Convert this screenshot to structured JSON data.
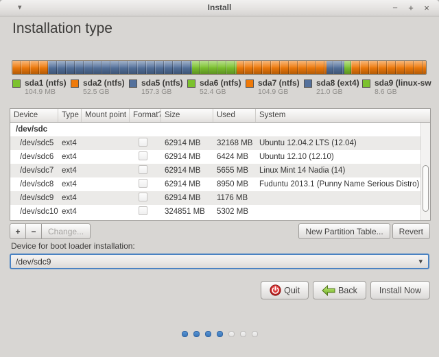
{
  "window": {
    "title": "Install",
    "menu_arrow": "▾",
    "minimize": "−",
    "maximize": "+",
    "close": "×"
  },
  "page": {
    "title": "Installation type"
  },
  "partition_bar": {
    "colors": {
      "orange": "#ef7a0a",
      "blue": "#54719c",
      "green": "#7cc22e"
    },
    "segments": [
      {
        "color": "orange",
        "width_pct": 8.6
      },
      {
        "color": "blue",
        "width_pct": 34.9
      },
      {
        "color": "green",
        "width_pct": 10.7
      },
      {
        "color": "orange",
        "width_pct": 21.8
      },
      {
        "color": "blue",
        "width_pct": 4.3
      },
      {
        "color": "green",
        "width_pct": 1.7
      },
      {
        "color": "orange",
        "width_pct": 18.0
      }
    ]
  },
  "legend": [
    {
      "name": "sda1 (ntfs)",
      "size": "104.9 MB",
      "color": "green"
    },
    {
      "name": "sda2 (ntfs)",
      "size": "52.5 GB",
      "color": "orange"
    },
    {
      "name": "sda5 (ntfs)",
      "size": "157.3 GB",
      "color": "blue"
    },
    {
      "name": "sda6 (ntfs)",
      "size": "52.4 GB",
      "color": "green"
    },
    {
      "name": "sda7 (ntfs)",
      "size": "104.9 GB",
      "color": "orange"
    },
    {
      "name": "sda8 (ext4)",
      "size": "21.0 GB",
      "color": "blue"
    },
    {
      "name": "sda9 (linux-sw",
      "size": "8.6 GB",
      "color": "green"
    }
  ],
  "table": {
    "columns": [
      "Device",
      "Type",
      "Mount point",
      "Format?",
      "Size",
      "Used",
      "System"
    ],
    "rows": [
      {
        "device": "/dev/sdc",
        "type": "",
        "mount_point": "",
        "size": "",
        "used": "",
        "system": ""
      },
      {
        "device": "/dev/sdc5",
        "type": "ext4",
        "mount_point": "",
        "size": "62914 MB",
        "used": "32168 MB",
        "system": "Ubuntu 12.04.2 LTS (12.04)"
      },
      {
        "device": "/dev/sdc6",
        "type": "ext4",
        "mount_point": "",
        "size": "62914 MB",
        "used": "6424 MB",
        "system": "Ubuntu 12.10 (12.10)"
      },
      {
        "device": "/dev/sdc7",
        "type": "ext4",
        "mount_point": "",
        "size": "62914 MB",
        "used": "5655 MB",
        "system": "Linux Mint 14 Nadia (14)"
      },
      {
        "device": "/dev/sdc8",
        "type": "ext4",
        "mount_point": "",
        "size": "62914 MB",
        "used": "8950 MB",
        "system": "Fuduntu 2013.1 (Punny Name Serious Distro)"
      },
      {
        "device": "/dev/sdc9",
        "type": "ext4",
        "mount_point": "",
        "size": "62914 MB",
        "used": "1176 MB",
        "system": ""
      },
      {
        "device": "/dev/sdc10",
        "type": "ext4",
        "mount_point": "",
        "size": "324851 MB",
        "used": "5302 MB",
        "system": ""
      }
    ]
  },
  "actions": {
    "add": "+",
    "remove": "−",
    "change": "Change...",
    "new_partition_table": "New Partition Table...",
    "revert": "Revert"
  },
  "bootloader": {
    "label": "Device for boot loader installation:",
    "selected": "/dev/sdc9",
    "arrow": "▾"
  },
  "footer": {
    "quit": "Quit",
    "back": "Back",
    "install_now": "Install Now"
  },
  "progress": {
    "total": 7,
    "current": 4
  }
}
